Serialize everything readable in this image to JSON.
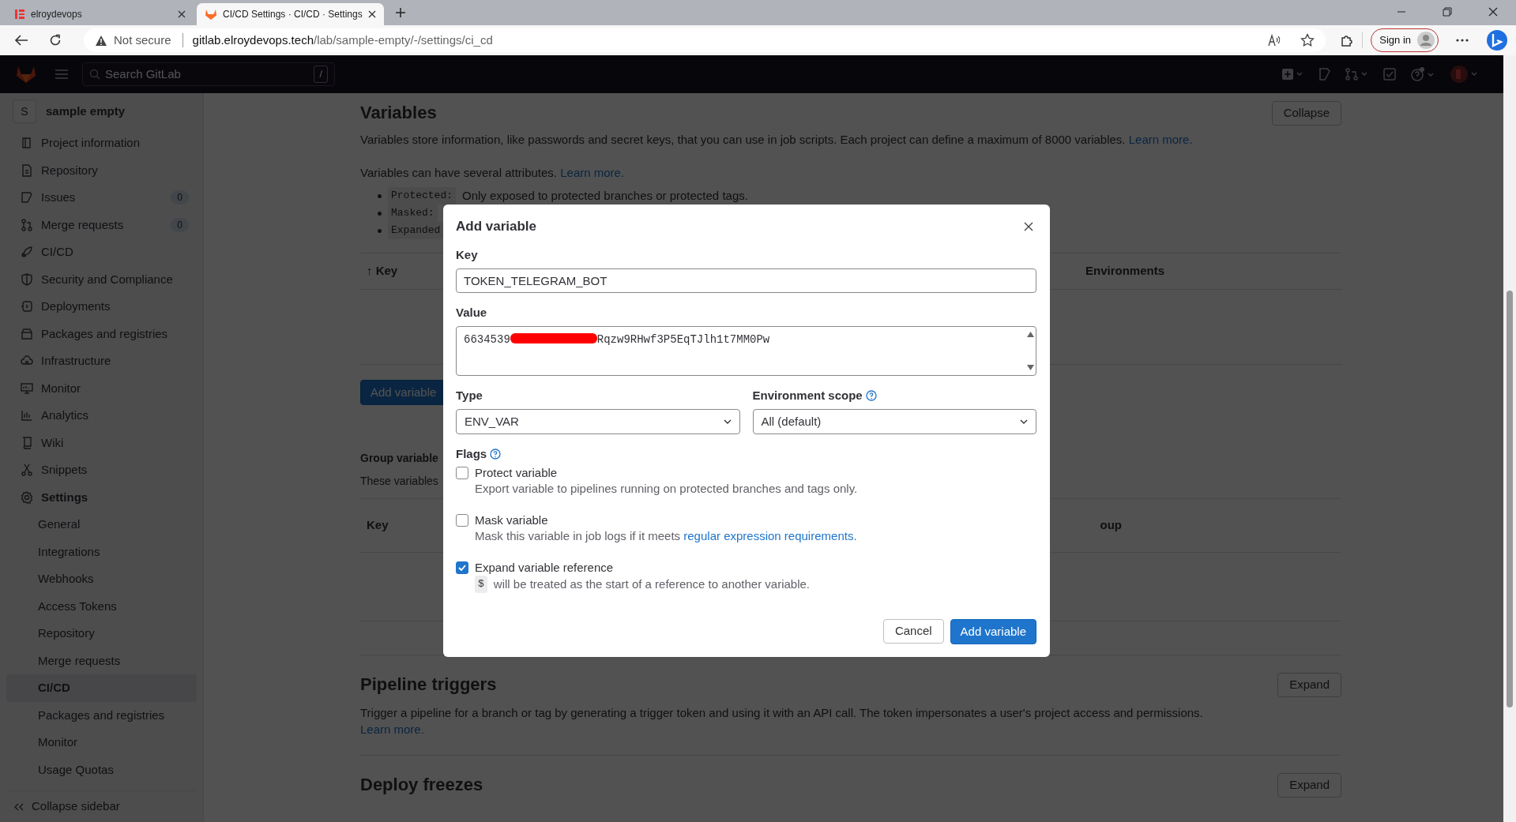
{
  "browser": {
    "tabs": [
      {
        "title": "elroydevops",
        "selected": false
      },
      {
        "title": "CI/CD Settings · CI/CD · Settings",
        "selected": true
      }
    ],
    "security": "Not secure",
    "url_host": "gitlab.elroydevops.tech",
    "url_path": "/lab/sample-empty/-/settings/ci_cd",
    "sign_in": "Sign in"
  },
  "topbar": {
    "search_placeholder": "Search GitLab",
    "search_shortcut": "/"
  },
  "sidebar": {
    "project_initial": "S",
    "project_name": "sample empty",
    "items": [
      {
        "label": "Project information",
        "expanded": false
      },
      {
        "label": "Repository",
        "expanded": false
      },
      {
        "label": "Issues",
        "count": "0",
        "expanded": false
      },
      {
        "label": "Merge requests",
        "count": "0",
        "expanded": false
      },
      {
        "label": "CI/CD",
        "expanded": false
      },
      {
        "label": "Security and Compliance",
        "expanded": false
      },
      {
        "label": "Deployments",
        "expanded": false
      },
      {
        "label": "Packages and registries",
        "expanded": false
      },
      {
        "label": "Infrastructure",
        "expanded": false
      },
      {
        "label": "Monitor",
        "expanded": false
      },
      {
        "label": "Analytics",
        "expanded": false
      },
      {
        "label": "Wiki",
        "expanded": false
      },
      {
        "label": "Snippets",
        "expanded": false
      },
      {
        "label": "Settings",
        "expanded": true,
        "children": [
          {
            "label": "General",
            "selected": false
          },
          {
            "label": "Integrations",
            "selected": false
          },
          {
            "label": "Webhooks",
            "selected": false
          },
          {
            "label": "Access Tokens",
            "selected": false
          },
          {
            "label": "Repository",
            "selected": false
          },
          {
            "label": "Merge requests",
            "selected": false
          },
          {
            "label": "CI/CD",
            "selected": true
          },
          {
            "label": "Packages and registries",
            "selected": false
          },
          {
            "label": "Monitor",
            "selected": false
          },
          {
            "label": "Usage Quotas",
            "selected": false
          }
        ]
      }
    ],
    "collapse": "Collapse sidebar"
  },
  "variables": {
    "title": "Variables",
    "collapse_button": "Collapse",
    "description": "Variables store information, like passwords and secret keys, that you can use in job scripts. Each project can define a maximum of 8000 variables.",
    "description_link": "Learn more.",
    "attributes_text": "Variables can have several attributes.",
    "attributes_link": "Learn more.",
    "attributes": [
      {
        "code": "Protected:",
        "text": "Only exposed to protected branches or protected tags."
      },
      {
        "code": "Masked:"
      },
      {
        "code": "Expanded"
      }
    ],
    "columns": [
      "↑ Key",
      "Environments"
    ],
    "add_button": "Add variable"
  },
  "group_variables": {
    "title": "Group variable",
    "description": "These variables",
    "columns": [
      "Key",
      "oup"
    ]
  },
  "pipeline_triggers": {
    "title": "Pipeline triggers",
    "description": "Trigger a pipeline for a branch or tag by generating a trigger token and using it with an API call. The token impersonates a user's project access and permissions.",
    "link": "Learn more.",
    "button": "Expand"
  },
  "deploy_freezes": {
    "title": "Deploy freezes",
    "button": "Expand"
  },
  "modal": {
    "title": "Add variable",
    "key_label": "Key",
    "key_value": "TOKEN_TELEGRAM_BOT",
    "value_label": "Value",
    "value_start": "6634539",
    "value_redacted": true,
    "value_end": "Rqzw9RHwf3P5EqTJlh1t7MM0Pw",
    "type_label": "Type",
    "type_value": "ENV_VAR",
    "scope_label": "Environment scope",
    "scope_value": "All (default)",
    "flags_label": "Flags",
    "flags": [
      {
        "label": "Protect variable",
        "help": "Export variable to pipelines running on protected branches and tags only.",
        "checked": false
      },
      {
        "label": "Mask variable",
        "help": "Mask this variable in job logs if it meets",
        "help_link": "regular expression requirements",
        "help_end": ".",
        "checked": false
      },
      {
        "label": "Expand variable reference",
        "help_code": "$",
        "help": "will be treated as the start of a reference to another variable.",
        "checked": true
      }
    ],
    "cancel": "Cancel",
    "submit": "Add variable"
  }
}
